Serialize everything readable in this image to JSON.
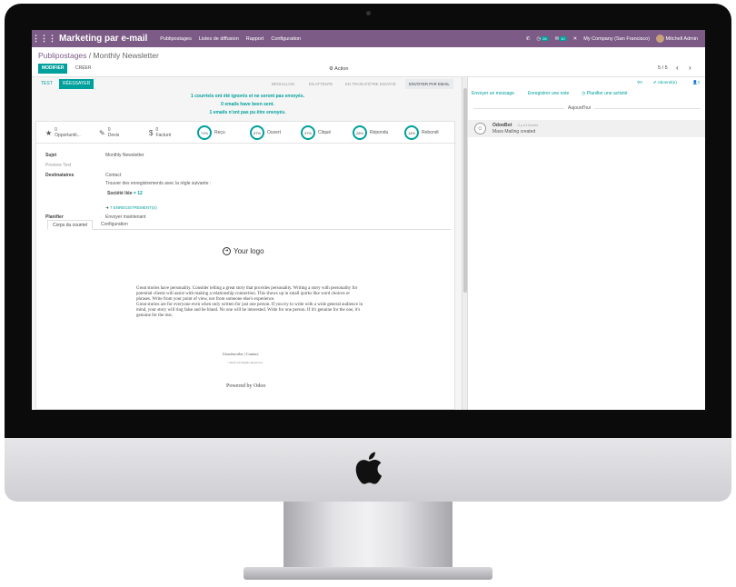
{
  "topbar": {
    "apps_icon": "apps-grid-icon",
    "title": "Marketing par e-mail",
    "menu": [
      "Publipostages",
      "Listes de diffusion",
      "Rapport",
      "Configuration"
    ],
    "phone_icon": "phone-icon",
    "activity_count": "26",
    "chat_count": "10",
    "company": "My Company (San Francisco)",
    "user": "Mitchell Admin",
    "accent": "#7c5b86"
  },
  "breadcrumb": {
    "parent": "Publipostages",
    "separator": "/",
    "current": "Monthly Newsletter"
  },
  "controls": {
    "edit": "MODIFIER",
    "create": "CRÉER",
    "action": "Action",
    "pager": "5 / 5"
  },
  "status_bar": {
    "test": "TEST",
    "retry": "RÉESSAYER",
    "stages": [
      "BROUILLON",
      "EN ATTENTE",
      "EN TRAIN D'ÊTRE ENVOYÉ",
      "ENVOYER PAR EMAIL"
    ],
    "active_stage_index": 3
  },
  "alerts": [
    {
      "count": "1",
      "text": "courriels ont été ignorés et ne seront pas envoyés."
    },
    {
      "count": "0",
      "text": "emails have been sent."
    },
    {
      "count": "1",
      "text": "emails n'ont pas pu être envoyés."
    }
  ],
  "stats": {
    "opportunities": {
      "count": "0",
      "label": "Opportuniti..."
    },
    "quotes": {
      "count": "0",
      "label": "Devis"
    },
    "invoiced": {
      "count": "0",
      "label": "Facturé"
    },
    "received": {
      "percent": "71%",
      "label": "Reçu"
    },
    "opened": {
      "percent": "57%",
      "label": "Ouvert"
    },
    "clicked": {
      "percent": "37%",
      "label": "Cliqué"
    },
    "replied": {
      "percent": "28%",
      "label": "Répondu"
    },
    "bounced": {
      "percent": "14%",
      "label": "Rebondi"
    }
  },
  "form": {
    "subject_label": "Sujet",
    "subject_value": "Monthly Newsletter",
    "preview_label": "Preview Text",
    "recipients_label": "Destinataires",
    "recipients_value": "Contact",
    "rule_text": "Trouver des enregistrements avec la règle suivante :",
    "rule_tag": "Société liée",
    "rule_tag_num": "12",
    "records_link": "7 ENREGISTREMENT(S)",
    "schedule_label": "Planifier",
    "schedule_value": "Envoyer maintenant"
  },
  "tabs": [
    "Corps du courriel",
    "Configuration"
  ],
  "email_body": {
    "logo_text": "Your logo",
    "paragraph1": "Great stories have personality. Consider telling a great story that provides personality. Writing a story with personality for potential clients will assist with making a relationship connection. This shows up in small quirks like word choices or phrases. Write from your point of view, not from someone else's experience.",
    "paragraph2": "Great stories are for everyone even when only written for just one person. If you try to write with a wide general audience in mind, your story will ring false and be bland. No one will be interested. Write for one person. If it's genuine for the one, it's genuine for the rest.",
    "unsubscribe": "Unsubscribe",
    "link_sep": "|",
    "contact": "Contact",
    "copyright": "©2020 All Rights Reserved",
    "powered_by": "Powered by Odoo"
  },
  "chatter": {
    "send_message": "Envoyer un message",
    "log_note": "Enregistrer une note",
    "schedule_activity": "Planifier une activité",
    "attachments": "0",
    "follow_status": "Abonné(e)",
    "followers": "2",
    "today": "Aujourd'hui",
    "message": {
      "author": "OdooBot",
      "date": "- Il y a 4 heures",
      "body": "Mass Mailing created"
    }
  }
}
